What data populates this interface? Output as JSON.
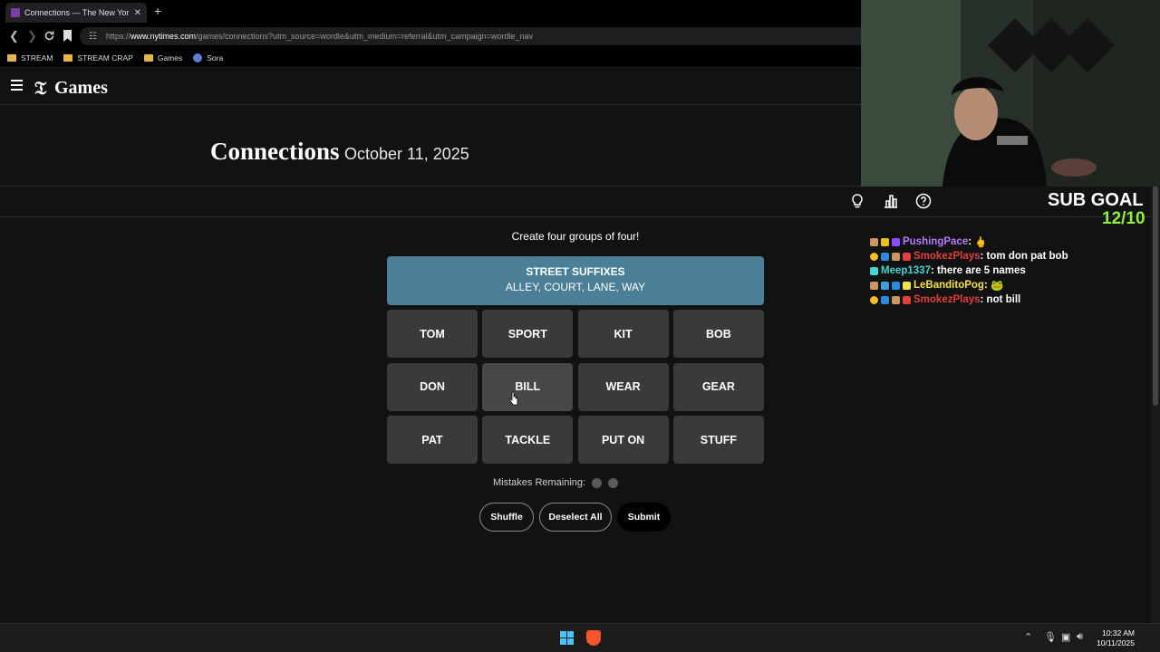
{
  "browser": {
    "tab_title": "Connections — The New Yor",
    "tab_close": "✕",
    "new_tab": "+",
    "url_prefix": "https://",
    "url_host": "www.nytimes.com",
    "url_path": "/games/connections?utm_source=wordle&utm_medium=referral&utm_campaign=wordle_nav",
    "bookmarks": [
      "STREAM",
      "STREAM CRAP",
      "Games",
      "Sora"
    ]
  },
  "site": {
    "logo_glyph": "𝔗",
    "name": "Games"
  },
  "puzzle": {
    "title": "Connections",
    "date": "October 11, 2025",
    "instructions": "Create four groups of four!",
    "solved": [
      {
        "category": "STREET SUFFIXES",
        "words": "ALLEY, COURT, LANE, WAY",
        "color": "#4a7f97"
      }
    ],
    "cards": [
      "TOM",
      "SPORT",
      "KIT",
      "BOB",
      "DON",
      "BILL",
      "WEAR",
      "GEAR",
      "PAT",
      "TACKLE",
      "PUT ON",
      "STUFF"
    ],
    "mistakes_label": "Mistakes Remaining:",
    "mistakes_remaining": 2,
    "buttons": {
      "shuffle": "Shuffle",
      "deselect": "Deselect All",
      "submit": "Submit"
    }
  },
  "overlay": {
    "sub_goal_label": "SUB GOAL",
    "sub_goal_count": "12/10",
    "chat": [
      {
        "user": "PushingPace",
        "color": "#b77cff",
        "message": "🖕"
      },
      {
        "user": "SmokezPlays",
        "color": "#e0413a",
        "message": "tom don pat bob"
      },
      {
        "user": "Meep1337",
        "color": "#44d6d0",
        "message": "there are 5 names"
      },
      {
        "user": "LeBanditoPog",
        "color": "#f2e24a",
        "message": "🐸"
      },
      {
        "user": "SmokezPlays",
        "color": "#e0413a",
        "message": "not bill"
      }
    ]
  },
  "taskbar": {
    "time": "10:32 AM",
    "date": "10/11/2025"
  }
}
